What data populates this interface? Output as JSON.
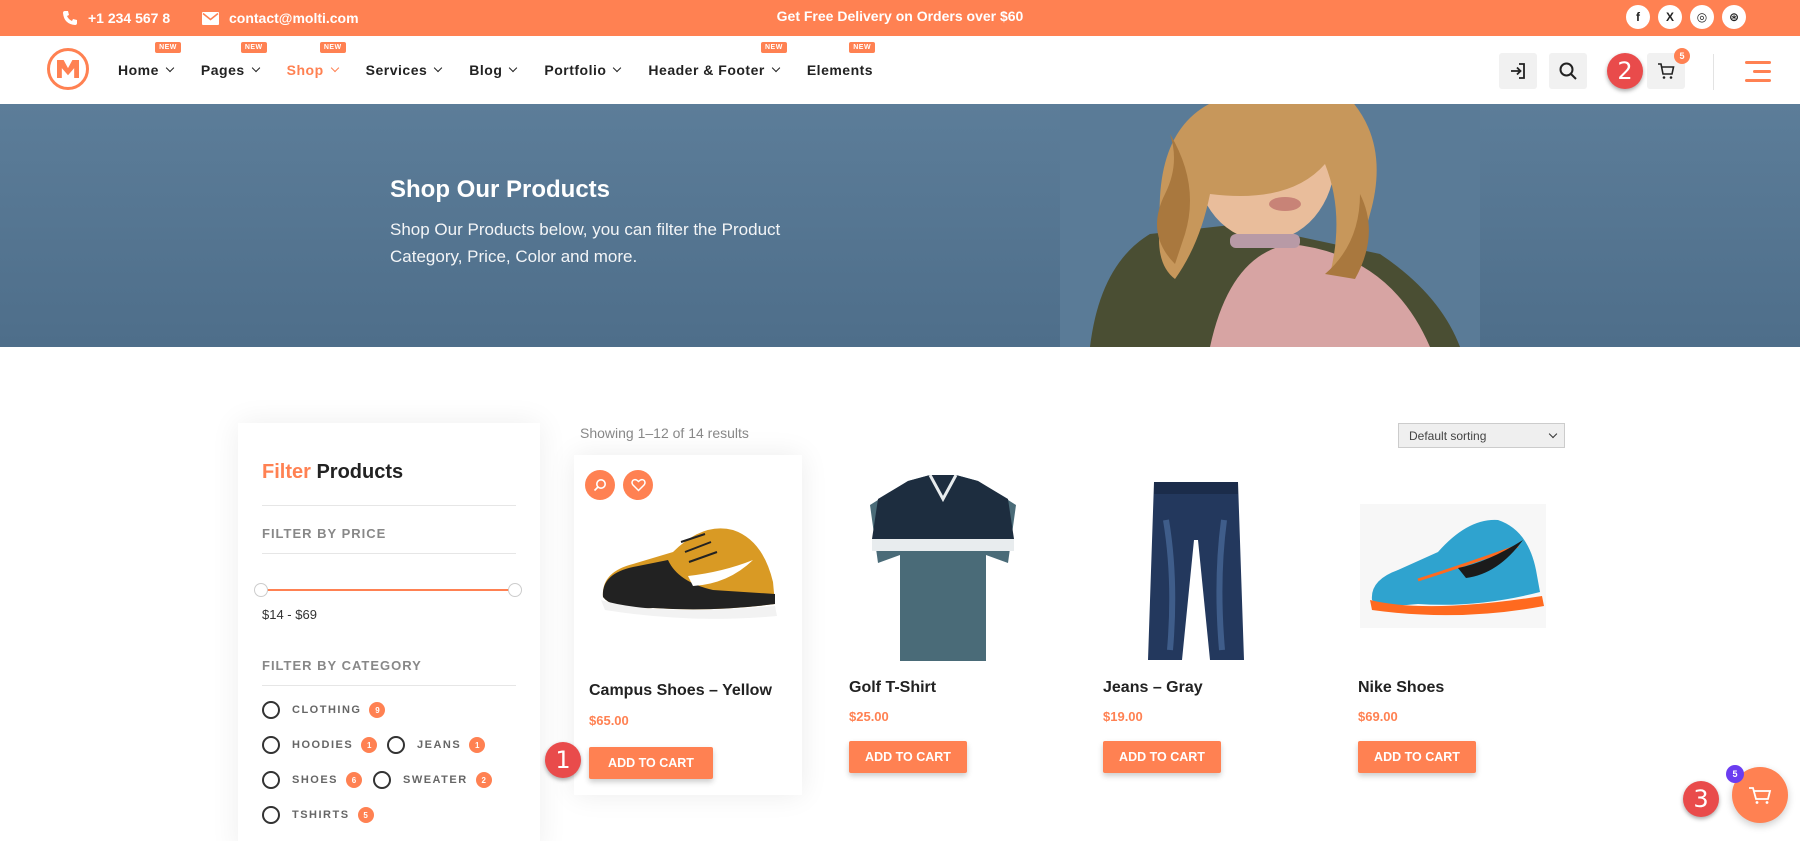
{
  "topbar": {
    "phone": "+1 234 567 8",
    "email": "contact@molti.com",
    "promo": "Get Free Delivery on Orders over $60",
    "socials": [
      {
        "icon": "facebook-icon",
        "glyph": "f"
      },
      {
        "icon": "x-twitter-icon",
        "glyph": "X"
      },
      {
        "icon": "instagram-icon",
        "glyph": "◎"
      },
      {
        "icon": "dribbble-icon",
        "glyph": "⊛"
      }
    ]
  },
  "nav": {
    "items": [
      {
        "label": "Home",
        "badge": "NEW",
        "dropdown": true
      },
      {
        "label": "Pages",
        "badge": "NEW",
        "dropdown": true
      },
      {
        "label": "Shop",
        "badge": "NEW",
        "dropdown": true,
        "active": true
      },
      {
        "label": "Services",
        "dropdown": true
      },
      {
        "label": "Blog",
        "dropdown": true
      },
      {
        "label": "Portfolio",
        "dropdown": true
      },
      {
        "label": "Header & Footer",
        "badge": "NEW",
        "dropdown": true
      },
      {
        "label": "Elements",
        "badge": "NEW",
        "dropdown": false
      }
    ],
    "cart_count": "5"
  },
  "markers": [
    "1",
    "2",
    "3"
  ],
  "hero": {
    "title": "Shop Our Products",
    "subtitle": "Shop Our Products below, you can filter the Product Category, Price, Color and more."
  },
  "filter": {
    "title_accent": "Filter",
    "title_rest": " Products",
    "price_heading": "FILTER BY PRICE",
    "price_range": "$14 - $69",
    "category_heading": "FILTER BY CATEGORY",
    "categories": [
      {
        "label": "CLOTHING",
        "count": "9"
      },
      {
        "label": "HOODIES",
        "count": "1"
      },
      {
        "label": "JEANS",
        "count": "1"
      },
      {
        "label": "SHOES",
        "count": "6"
      },
      {
        "label": "SWEATER",
        "count": "2"
      },
      {
        "label": "TSHIRTS",
        "count": "5"
      }
    ]
  },
  "shop": {
    "results": "Showing 1–12 of 14 results",
    "sort_selected": "Default sorting",
    "add_label": "ADD TO CART",
    "products": [
      {
        "name": "Campus Shoes – Yellow",
        "price": "$65.00"
      },
      {
        "name": "Golf T-Shirt",
        "price": "$25.00"
      },
      {
        "name": "Jeans – Gray",
        "price": "$19.00"
      },
      {
        "name": "Nike Shoes",
        "price": "$69.00"
      }
    ]
  },
  "floating_cart": {
    "count": "5"
  },
  "colors": {
    "accent": "#ff8152",
    "marker": "#e94b4b",
    "hero_bg": "#5c7d99",
    "badge_purple": "#6b3df0"
  }
}
